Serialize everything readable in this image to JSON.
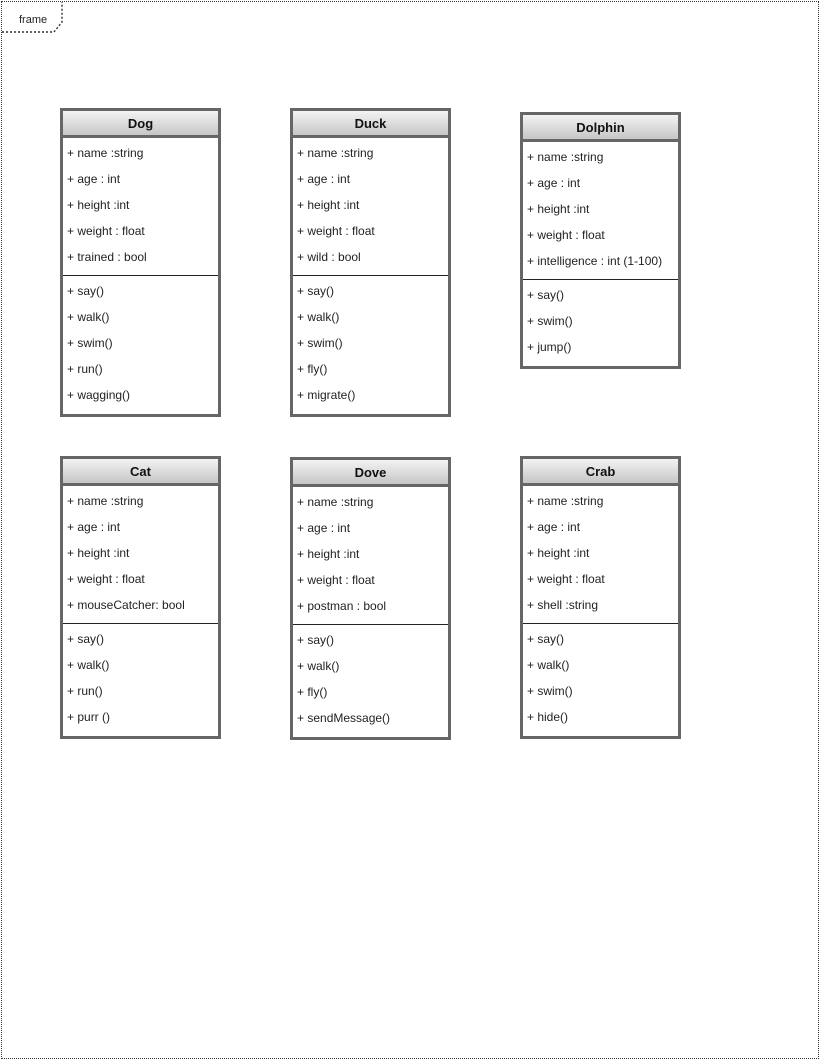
{
  "frame": {
    "label": "frame"
  },
  "classes": [
    {
      "name": "Dog",
      "attributes": [
        "+ name :string",
        "+ age : int",
        "+ height :int",
        "+ weight : float",
        "+ trained : bool"
      ],
      "methods": [
        "+ say()",
        "+ walk()",
        "+ swim()",
        "+ run()",
        "+ wagging()"
      ]
    },
    {
      "name": "Duck",
      "attributes": [
        "+ name :string",
        "+ age : int",
        "+ height :int",
        "+ weight : float",
        "+ wild : bool"
      ],
      "methods": [
        "+ say()",
        "+ walk()",
        "+ swim()",
        "+ fly()",
        "+ migrate()"
      ]
    },
    {
      "name": "Dolphin",
      "attributes": [
        "+ name :string",
        "+ age : int",
        "+ height :int",
        "+ weight : float",
        "+ intelligence : int (1-100)"
      ],
      "methods": [
        "+ say()",
        "+ swim()",
        "+ jump()"
      ]
    },
    {
      "name": "Cat",
      "attributes": [
        "+ name :string",
        "+ age : int",
        "+ height :int",
        "+ weight : float",
        "+ mouseCatcher: bool"
      ],
      "methods": [
        "+ say()",
        "+ walk()",
        "+ run()",
        "+ purr ()"
      ]
    },
    {
      "name": "Dove",
      "attributes": [
        "+ name :string",
        "+ age : int",
        "+ height :int",
        "+ weight : float",
        "+ postman : bool"
      ],
      "methods": [
        "+ say()",
        "+ walk()",
        "+ fly()",
        "+ sendMessage()"
      ]
    },
    {
      "name": "Crab",
      "attributes": [
        "+ name :string",
        "+ age : int",
        "+ height :int",
        "+ weight : float",
        "+ shell :string"
      ],
      "methods": [
        "+ say()",
        "+ walk()",
        "+ swim()",
        "+ hide()"
      ]
    }
  ]
}
